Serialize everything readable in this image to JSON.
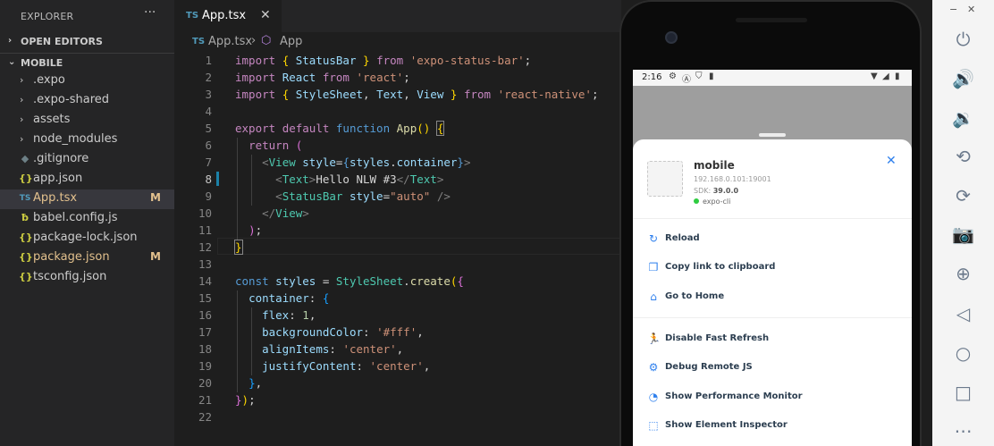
{
  "sidebar": {
    "header": "EXPLORER",
    "more": "···",
    "sections": [
      {
        "label": "OPEN EDITORS",
        "chevron": "›"
      },
      {
        "label": "MOBILE",
        "chevron": "⌄"
      }
    ],
    "items": [
      {
        "name": ".expo",
        "type": "folder"
      },
      {
        "name": ".expo-shared",
        "type": "folder"
      },
      {
        "name": "assets",
        "type": "folder"
      },
      {
        "name": "node_modules",
        "type": "folder"
      },
      {
        "name": ".gitignore",
        "type": "file",
        "icon": "◆"
      },
      {
        "name": "app.json",
        "type": "file",
        "icon": "{}"
      },
      {
        "name": "App.tsx",
        "type": "file",
        "icon": "TS",
        "badge": "M"
      },
      {
        "name": "babel.config.js",
        "type": "file",
        "icon": "ƀ"
      },
      {
        "name": "package-lock.json",
        "type": "file",
        "icon": "{}"
      },
      {
        "name": "package.json",
        "type": "file",
        "icon": "{}",
        "badge": "M"
      },
      {
        "name": "tsconfig.json",
        "type": "file",
        "icon": "{}"
      }
    ]
  },
  "editor": {
    "tab": {
      "lang": "TS",
      "title": "App.tsx",
      "close": "✕"
    },
    "breadcrumb": {
      "lang": "TS",
      "file": "App.tsx",
      "separator": "›",
      "symbol": "App"
    },
    "line_numbers": [
      "1",
      "2",
      "3",
      "4",
      "5",
      "6",
      "7",
      "8",
      "9",
      "10",
      "11",
      "12",
      "13",
      "14",
      "15",
      "16",
      "17",
      "18",
      "19",
      "20",
      "21",
      "22"
    ]
  },
  "phone": {
    "status": {
      "time": "2:16"
    },
    "sheet": {
      "app_name": "mobile",
      "url": "192.168.0.101:19001",
      "sdk_label": "SDK:",
      "sdk_version": "39.0.0",
      "host": "expo-cli",
      "close": "✕",
      "actions": [
        {
          "label": "Reload",
          "icon": "↻"
        },
        {
          "label": "Copy link to clipboard",
          "icon": "❐"
        },
        {
          "label": "Go to Home",
          "icon": "⌂"
        },
        {
          "label": "Disable Fast Refresh",
          "icon": "🏃"
        },
        {
          "label": "Debug Remote JS",
          "icon": "⚙"
        },
        {
          "label": "Show Performance Monitor",
          "icon": "◔"
        },
        {
          "label": "Show Element Inspector",
          "icon": "⬚"
        }
      ]
    }
  },
  "emulator": {
    "minimize": "−",
    "close": "✕",
    "buttons": [
      {
        "name": "power-icon",
        "glyph": "⏻"
      },
      {
        "name": "volume-up-icon",
        "glyph": "🔊"
      },
      {
        "name": "volume-down-icon",
        "glyph": "🔉"
      },
      {
        "name": "rotate-left-icon",
        "glyph": "⟲"
      },
      {
        "name": "rotate-right-icon",
        "glyph": "⟳"
      },
      {
        "name": "camera-icon",
        "glyph": "📷"
      },
      {
        "name": "zoom-icon",
        "glyph": "⊕"
      },
      {
        "name": "back-icon",
        "glyph": "◁"
      },
      {
        "name": "home-icon",
        "glyph": "○"
      },
      {
        "name": "overview-icon",
        "glyph": "□"
      },
      {
        "name": "more-icon",
        "glyph": "⋯"
      }
    ]
  },
  "colors": {
    "accent": "#2f80ed",
    "modified": "#e2c08d",
    "typescript": "#519aba"
  }
}
